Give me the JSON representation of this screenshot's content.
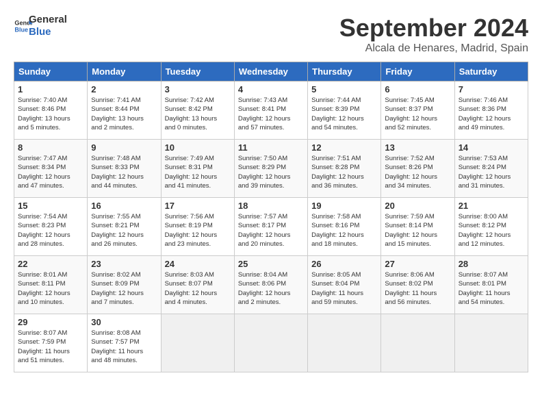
{
  "logo": {
    "line1": "General",
    "line2": "Blue"
  },
  "title": "September 2024",
  "subtitle": "Alcala de Henares, Madrid, Spain",
  "days_of_week": [
    "Sunday",
    "Monday",
    "Tuesday",
    "Wednesday",
    "Thursday",
    "Friday",
    "Saturday"
  ],
  "weeks": [
    [
      {
        "day": 1,
        "info": "Sunrise: 7:40 AM\nSunset: 8:46 PM\nDaylight: 13 hours\nand 5 minutes."
      },
      {
        "day": 2,
        "info": "Sunrise: 7:41 AM\nSunset: 8:44 PM\nDaylight: 13 hours\nand 2 minutes."
      },
      {
        "day": 3,
        "info": "Sunrise: 7:42 AM\nSunset: 8:42 PM\nDaylight: 13 hours\nand 0 minutes."
      },
      {
        "day": 4,
        "info": "Sunrise: 7:43 AM\nSunset: 8:41 PM\nDaylight: 12 hours\nand 57 minutes."
      },
      {
        "day": 5,
        "info": "Sunrise: 7:44 AM\nSunset: 8:39 PM\nDaylight: 12 hours\nand 54 minutes."
      },
      {
        "day": 6,
        "info": "Sunrise: 7:45 AM\nSunset: 8:37 PM\nDaylight: 12 hours\nand 52 minutes."
      },
      {
        "day": 7,
        "info": "Sunrise: 7:46 AM\nSunset: 8:36 PM\nDaylight: 12 hours\nand 49 minutes."
      }
    ],
    [
      {
        "day": 8,
        "info": "Sunrise: 7:47 AM\nSunset: 8:34 PM\nDaylight: 12 hours\nand 47 minutes."
      },
      {
        "day": 9,
        "info": "Sunrise: 7:48 AM\nSunset: 8:33 PM\nDaylight: 12 hours\nand 44 minutes."
      },
      {
        "day": 10,
        "info": "Sunrise: 7:49 AM\nSunset: 8:31 PM\nDaylight: 12 hours\nand 41 minutes."
      },
      {
        "day": 11,
        "info": "Sunrise: 7:50 AM\nSunset: 8:29 PM\nDaylight: 12 hours\nand 39 minutes."
      },
      {
        "day": 12,
        "info": "Sunrise: 7:51 AM\nSunset: 8:28 PM\nDaylight: 12 hours\nand 36 minutes."
      },
      {
        "day": 13,
        "info": "Sunrise: 7:52 AM\nSunset: 8:26 PM\nDaylight: 12 hours\nand 34 minutes."
      },
      {
        "day": 14,
        "info": "Sunrise: 7:53 AM\nSunset: 8:24 PM\nDaylight: 12 hours\nand 31 minutes."
      }
    ],
    [
      {
        "day": 15,
        "info": "Sunrise: 7:54 AM\nSunset: 8:23 PM\nDaylight: 12 hours\nand 28 minutes."
      },
      {
        "day": 16,
        "info": "Sunrise: 7:55 AM\nSunset: 8:21 PM\nDaylight: 12 hours\nand 26 minutes."
      },
      {
        "day": 17,
        "info": "Sunrise: 7:56 AM\nSunset: 8:19 PM\nDaylight: 12 hours\nand 23 minutes."
      },
      {
        "day": 18,
        "info": "Sunrise: 7:57 AM\nSunset: 8:17 PM\nDaylight: 12 hours\nand 20 minutes."
      },
      {
        "day": 19,
        "info": "Sunrise: 7:58 AM\nSunset: 8:16 PM\nDaylight: 12 hours\nand 18 minutes."
      },
      {
        "day": 20,
        "info": "Sunrise: 7:59 AM\nSunset: 8:14 PM\nDaylight: 12 hours\nand 15 minutes."
      },
      {
        "day": 21,
        "info": "Sunrise: 8:00 AM\nSunset: 8:12 PM\nDaylight: 12 hours\nand 12 minutes."
      }
    ],
    [
      {
        "day": 22,
        "info": "Sunrise: 8:01 AM\nSunset: 8:11 PM\nDaylight: 12 hours\nand 10 minutes."
      },
      {
        "day": 23,
        "info": "Sunrise: 8:02 AM\nSunset: 8:09 PM\nDaylight: 12 hours\nand 7 minutes."
      },
      {
        "day": 24,
        "info": "Sunrise: 8:03 AM\nSunset: 8:07 PM\nDaylight: 12 hours\nand 4 minutes."
      },
      {
        "day": 25,
        "info": "Sunrise: 8:04 AM\nSunset: 8:06 PM\nDaylight: 12 hours\nand 2 minutes."
      },
      {
        "day": 26,
        "info": "Sunrise: 8:05 AM\nSunset: 8:04 PM\nDaylight: 11 hours\nand 59 minutes."
      },
      {
        "day": 27,
        "info": "Sunrise: 8:06 AM\nSunset: 8:02 PM\nDaylight: 11 hours\nand 56 minutes."
      },
      {
        "day": 28,
        "info": "Sunrise: 8:07 AM\nSunset: 8:01 PM\nDaylight: 11 hours\nand 54 minutes."
      }
    ],
    [
      {
        "day": 29,
        "info": "Sunrise: 8:07 AM\nSunset: 7:59 PM\nDaylight: 11 hours\nand 51 minutes."
      },
      {
        "day": 30,
        "info": "Sunrise: 8:08 AM\nSunset: 7:57 PM\nDaylight: 11 hours\nand 48 minutes."
      },
      null,
      null,
      null,
      null,
      null
    ]
  ]
}
